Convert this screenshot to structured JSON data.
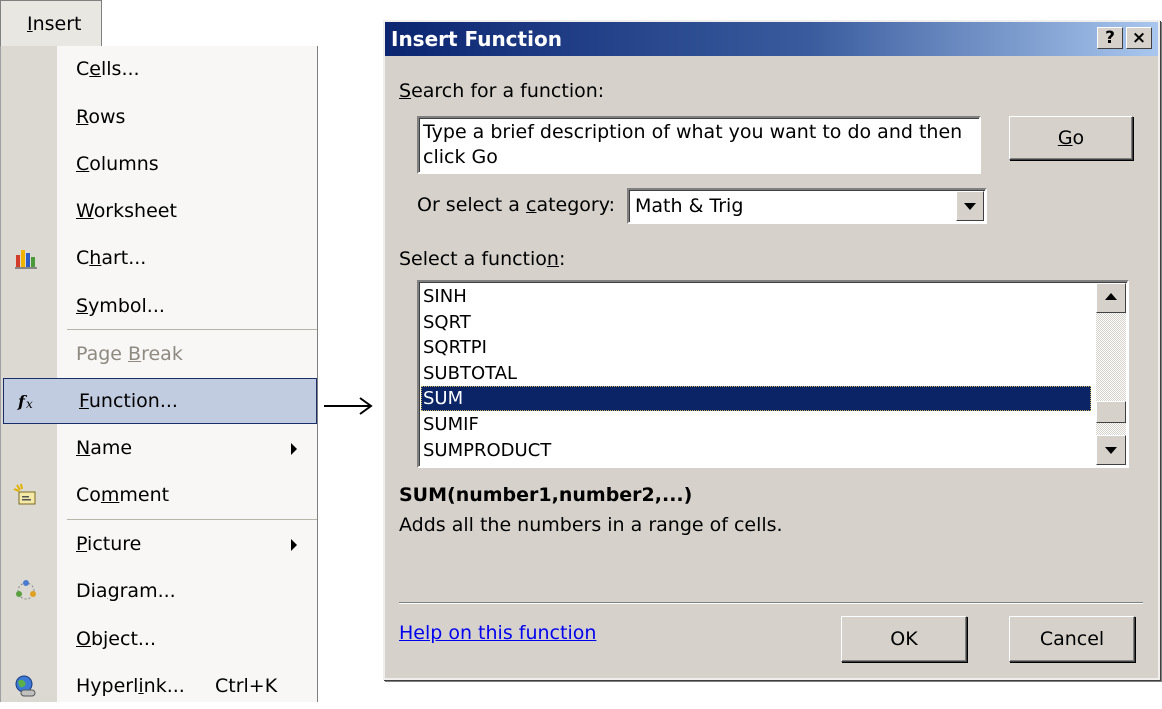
{
  "menu": {
    "tab_label": "Insert",
    "tab_mnemonic": "I",
    "items": [
      {
        "label": "Cells...",
        "pre": "C",
        "mn": "e",
        "post": "lls...",
        "icon": ""
      },
      {
        "label": "Rows",
        "pre": "",
        "mn": "R",
        "post": "ows",
        "icon": ""
      },
      {
        "label": "Columns",
        "pre": "",
        "mn": "C",
        "post": "olumns",
        "icon": ""
      },
      {
        "label": "Worksheet",
        "pre": "",
        "mn": "W",
        "post": "orksheet",
        "icon": ""
      },
      {
        "label": "Chart...",
        "pre": "C",
        "mn": "h",
        "post": "art...",
        "icon": "chart-icon"
      },
      {
        "label": "Symbol...",
        "pre": "",
        "mn": "S",
        "post": "ymbol...",
        "icon": ""
      },
      {
        "label": "Page Break",
        "pre": "Page ",
        "mn": "B",
        "post": "reak",
        "icon": "",
        "disabled": true
      },
      {
        "label": "Function...",
        "pre": "",
        "mn": "F",
        "post": "unction...",
        "icon": "function-fx-icon",
        "highlighted": true
      },
      {
        "label": "Name",
        "pre": "",
        "mn": "N",
        "post": "ame",
        "icon": "",
        "submenu": true
      },
      {
        "label": "Comment",
        "pre": "Co",
        "mn": "m",
        "post": "ment",
        "icon": "comment-icon"
      },
      {
        "label": "Picture",
        "pre": "",
        "mn": "P",
        "post": "icture",
        "icon": "",
        "submenu": true
      },
      {
        "label": "Diagram...",
        "pre": "Dia",
        "mn": "g",
        "post": "ram...",
        "icon": "diagram-icon"
      },
      {
        "label": "Object...",
        "pre": "",
        "mn": "O",
        "post": "bject...",
        "icon": ""
      },
      {
        "label": "Hyperlink...",
        "pre": "Hyperl",
        "mn": "i",
        "post": "nk...",
        "icon": "hyperlink-globe-icon",
        "shortcut": "Ctrl+K"
      }
    ]
  },
  "flow_arrow": "→",
  "dialog": {
    "title": "Insert Function",
    "help_btn": "?",
    "close_btn": "×",
    "search_label_mn": "S",
    "search_label_rest": "earch for a function:",
    "search_value": "Type a brief description of what you want to do and then click Go",
    "go_mn": "G",
    "go_rest": "o",
    "category_label_pre": "Or select a ",
    "category_label_mn": "c",
    "category_label_post": "ategory:",
    "category_value": "Math & Trig",
    "function_label_pre": "Select a functio",
    "function_label_mn": "n",
    "function_label_post": ":",
    "functions": [
      "SINH",
      "SQRT",
      "SQRTPI",
      "SUBTOTAL",
      "SUM",
      "SUMIF",
      "SUMPRODUCT"
    ],
    "selected_function": "SUM",
    "signature": "SUM(number1,number2,...)",
    "description": "Adds all the numbers in a range of cells.",
    "help_link": "Help on this function",
    "ok_label": "OK",
    "cancel_label": "Cancel"
  },
  "colors": {
    "title_gradient_start": "#0b2571",
    "title_gradient_end": "#a9c7ee",
    "selection_bg": "#0a2466",
    "menu_highlight_bg": "#c1cce0",
    "link": "#0000ee"
  }
}
